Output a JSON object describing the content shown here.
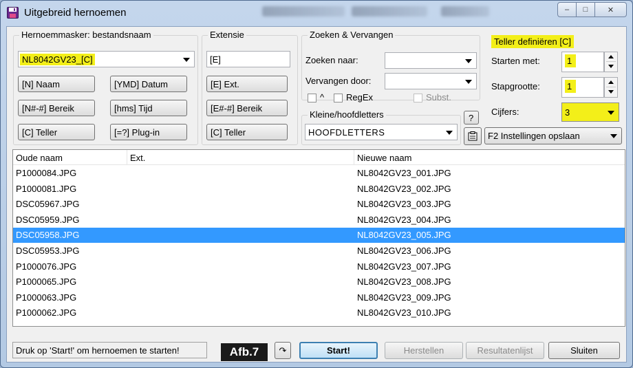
{
  "window": {
    "title": "Uitgebreid hernoemen",
    "controls": {
      "minimize": "–",
      "maximize": "□",
      "close": "✕"
    }
  },
  "mask_group": {
    "title": "Hernoemmasker: bestandsnaam",
    "mask_value": "NL8042GV23_[C]",
    "buttons": [
      "[N] Naam",
      "[YMD] Datum",
      "[N#-#] Bereik",
      "[hms] Tijd",
      "[C] Teller",
      "[=?] Plug-in"
    ]
  },
  "extension_group": {
    "title": "Extensie",
    "value": "[E]",
    "buttons": [
      "[E] Ext.",
      "[E#-#] Bereik",
      "[C] Teller"
    ]
  },
  "search_group": {
    "title": "Zoeken & Vervangen",
    "search_label": "Zoeken naar:",
    "replace_label": "Vervangen door:",
    "search_value": "",
    "replace_value": "",
    "caret_label": "^",
    "regex_label": "RegEx",
    "subst_label": "Subst."
  },
  "case_group": {
    "title": "Kleine/hoofdletters",
    "value": "HOOFDLETTERS"
  },
  "counter_group": {
    "title": "Teller definiëren [C]",
    "start_label": "Starten met:",
    "start_value": "1",
    "step_label": "Stapgrootte:",
    "step_value": "1",
    "digits_label": "Cijfers:",
    "digits_value": "3"
  },
  "help_label": "?",
  "settings_combo": "F2 Instellingen opslaan",
  "file_list": {
    "columns": [
      "Oude naam",
      "Ext.",
      "Nieuwe naam"
    ],
    "rows": [
      {
        "old": "P1000084.JPG",
        "new": "NL8042GV23_001.JPG"
      },
      {
        "old": "P1000081.JPG",
        "new": "NL8042GV23_002.JPG"
      },
      {
        "old": "DSC05967.JPG",
        "new": "NL8042GV23_003.JPG"
      },
      {
        "old": "DSC05959.JPG",
        "new": "NL8042GV23_004.JPG"
      },
      {
        "old": "DSC05958.JPG",
        "new": "NL8042GV23_005.JPG"
      },
      {
        "old": "DSC05953.JPG",
        "new": "NL8042GV23_006.JPG"
      },
      {
        "old": "P1000076.JPG",
        "new": "NL8042GV23_007.JPG"
      },
      {
        "old": "P1000065.JPG",
        "new": "NL8042GV23_008.JPG"
      },
      {
        "old": "P1000063.JPG",
        "new": "NL8042GV23_009.JPG"
      },
      {
        "old": "P1000062.JPG",
        "new": "NL8042GV23_010.JPG"
      }
    ],
    "selected_index": 4
  },
  "status_text": "Druk op 'Start!' om hernoemen te starten!",
  "figure_label": "Afb.7",
  "bottom_buttons": {
    "undo_icon": "↷",
    "start": "Start!",
    "restore": "Herstellen",
    "results": "Resultatenlijst",
    "close": "Sluiten"
  },
  "colors": {
    "highlight": "#f3ef19",
    "selection": "#3399ff"
  }
}
